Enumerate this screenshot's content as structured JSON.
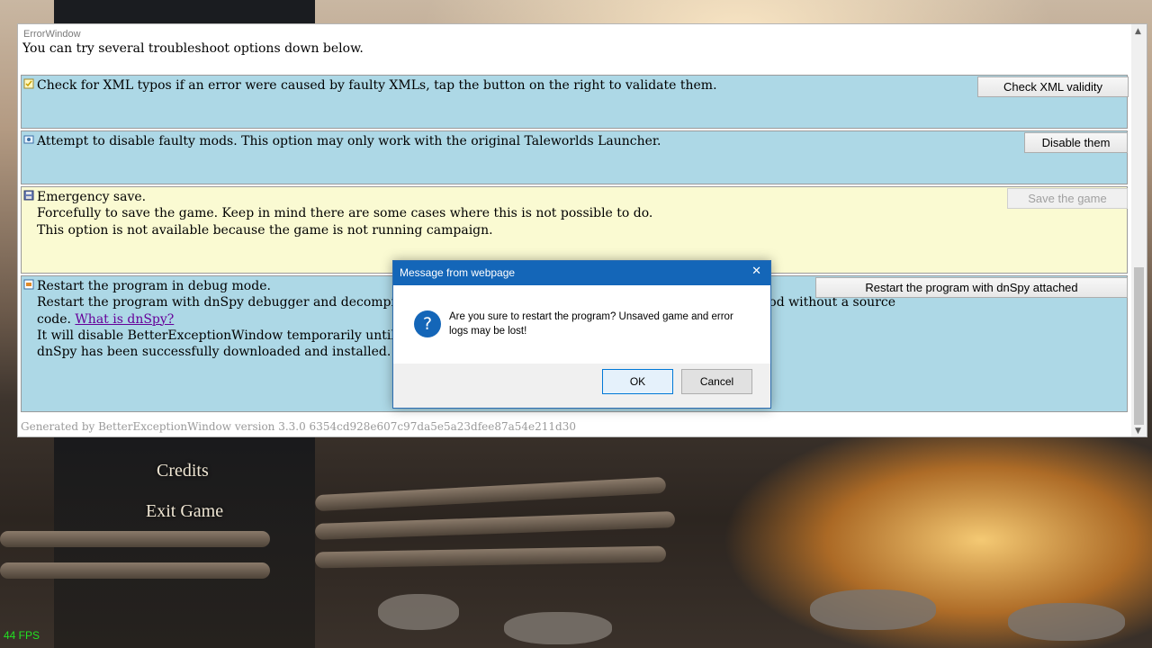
{
  "game": {
    "menu": [
      "Credits",
      "Exit Game"
    ],
    "fps": "44 FPS"
  },
  "error_window": {
    "title": "ErrorWindow",
    "intro": "You can try several troubleshoot options down below.",
    "options": [
      {
        "lines": [
          "Check for XML typos if an error were caused by faulty XMLs, tap the button on the right to validate them."
        ],
        "button": "Check XML validity"
      },
      {
        "lines": [
          "Attempt to disable faulty mods. This option may only work with the original Taleworlds Launcher."
        ],
        "button": "Disable them"
      },
      {
        "lines": [
          "Emergency save.",
          "Forcefully to save the game. Keep in mind there are some cases where this is not possible to do.",
          "This option is not available because the game is not running campaign."
        ],
        "button": "Save the game"
      },
      {
        "lines": [
          "Restart the program in debug mode.",
          "Restart the program with dnSpy debugger and decompiler attac",
          "mod without a source",
          "code.",
          "What is dnSpy?",
          "It will disable BetterExceptionWindow temporarily until the ne",
          "dnSpy has been successfully downloaded and installed."
        ],
        "button": "Restart the program with dnSpy attached"
      }
    ],
    "footer": "Generated by BetterExceptionWindow version 3.3.0 6354cd928e607c97da5e5a23dfee87a54e211d30"
  },
  "dialog": {
    "title": "Message from webpage",
    "message": "Are you sure to restart the program? Unsaved game and error logs may be lost!",
    "ok": "OK",
    "cancel": "Cancel",
    "icon": "question-icon"
  }
}
